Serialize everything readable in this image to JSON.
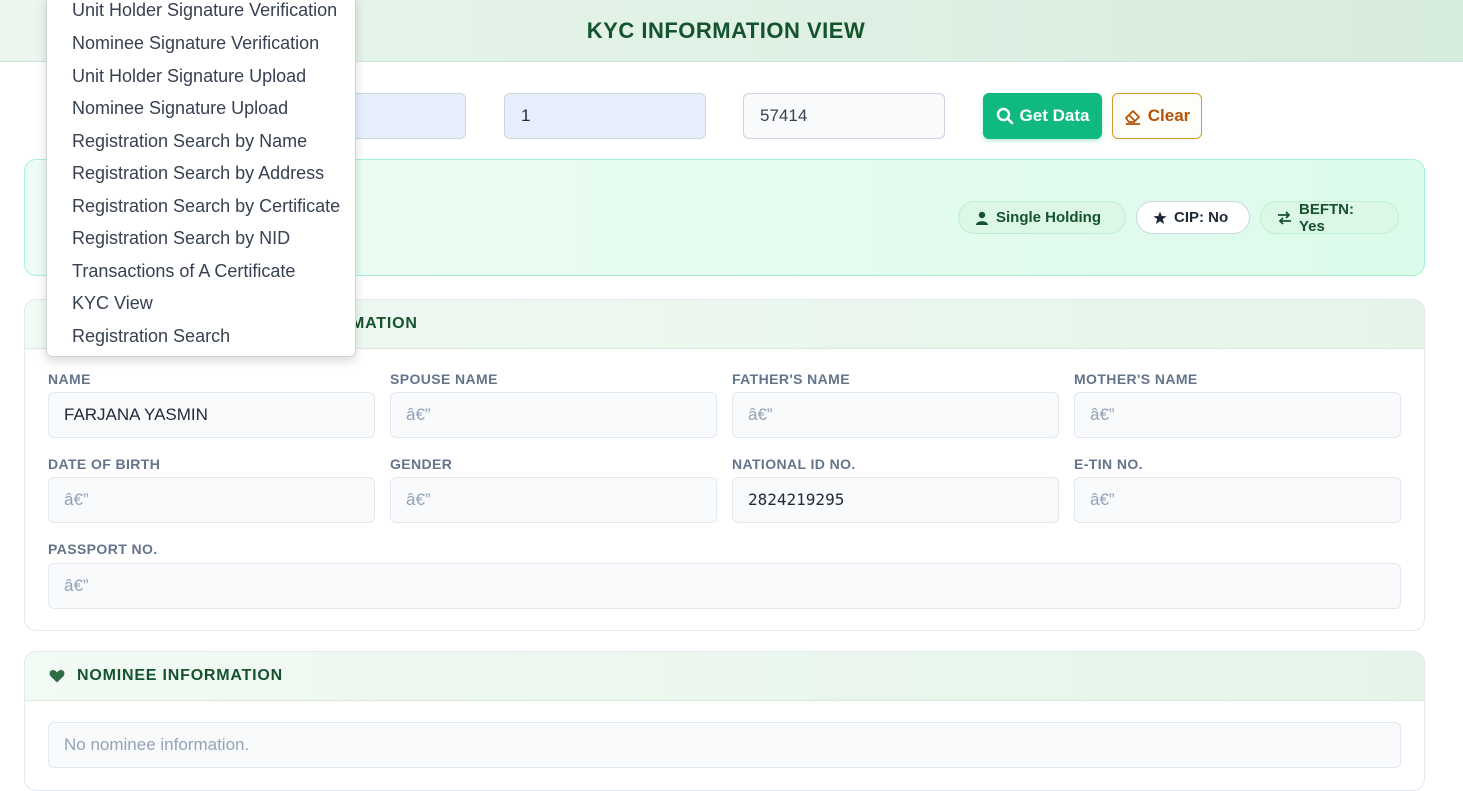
{
  "header": {
    "title": "KYC INFORMATION VIEW"
  },
  "search": {
    "field2_value": "1",
    "field3_value": "57414",
    "get_data_label": "Get Data",
    "clear_label": "Clear"
  },
  "summary": {
    "pills": [
      {
        "label": "Single Holding",
        "icon": "user-icon"
      },
      {
        "label": "CIP: No",
        "icon": "star-icon"
      },
      {
        "label": "BEFTN: Yes",
        "icon": "transfer-icon"
      }
    ]
  },
  "personal": {
    "title_visible": "MATION",
    "fields": {
      "name": {
        "label": "NAME",
        "value": "FARJANA YASMIN"
      },
      "spouse": {
        "label": "SPOUSE NAME",
        "value": "â€”"
      },
      "father": {
        "label": "FATHER'S NAME",
        "value": "â€”"
      },
      "mother": {
        "label": "MOTHER'S NAME",
        "value": "â€”"
      },
      "dob": {
        "label": "DATE OF BIRTH",
        "value": "â€”"
      },
      "gender": {
        "label": "GENDER",
        "value": "â€”"
      },
      "nid": {
        "label": "NATIONAL ID NO.",
        "value": "2824219295"
      },
      "etin": {
        "label": "E-TIN NO.",
        "value": "â€”"
      },
      "passport": {
        "label": "PASSPORT NO.",
        "value": "â€”"
      }
    }
  },
  "nominee": {
    "title": "NOMINEE INFORMATION",
    "empty_text": "No nominee information."
  },
  "dropdown": {
    "items": [
      "Unit Holder Signature Verification",
      "Nominee Signature Verification",
      "Unit Holder Signature Upload",
      "Nominee Signature Upload",
      "Registration Search by Name",
      "Registration Search by Address",
      "Registration Search by Certificate",
      "Registration Search by NID",
      "Transactions of A Certificate",
      "KYC View",
      "Registration Search"
    ]
  },
  "colors": {
    "accent_green": "#10b981",
    "heading_green": "#14532d",
    "clear_orange": "#b45309"
  }
}
